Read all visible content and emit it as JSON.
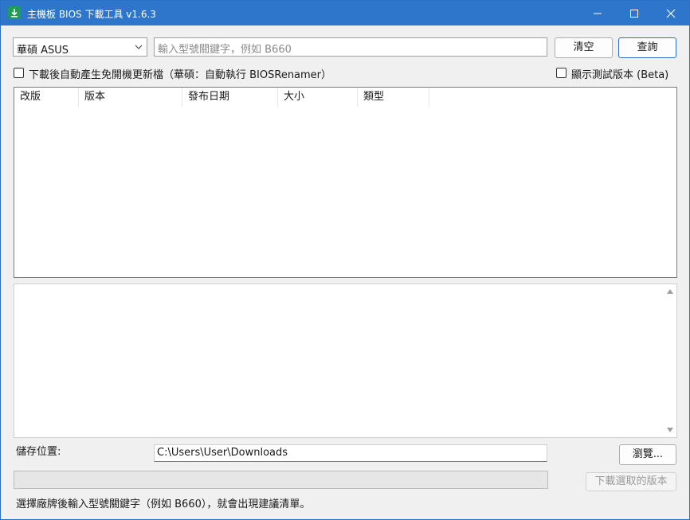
{
  "window": {
    "title": "主機板 BIOS 下載工具  v1.6.3",
    "icon": "download-arrow-icon"
  },
  "toolbar": {
    "brand_selected": "華碩 ASUS",
    "search_placeholder": "輸入型號關鍵字，例如 B660",
    "search_value": "",
    "clear_label": "清空",
    "query_label": "查詢"
  },
  "options": {
    "rename_label": "下載後自動產生免開機更新檔（華碩：自動執行 BIOSRenamer）",
    "rename_checked": false,
    "beta_label": "顯示測試版本 (Beta)",
    "beta_checked": false
  },
  "table": {
    "columns": [
      "改版",
      "版本",
      "發布日期",
      "大小",
      "類型"
    ],
    "rows": []
  },
  "log": {
    "text": ""
  },
  "save": {
    "label": "儲存位置:",
    "path": "C:\\Users\\User\\Downloads",
    "browse_label": "瀏覽..."
  },
  "progress": {
    "value": 0
  },
  "download": {
    "label": "下載選取的版本",
    "enabled": false
  },
  "status": {
    "text": "選擇廠牌後輸入型號關鍵字（例如 B660），就會出現建議清單。"
  },
  "colors": {
    "titlebar": "#2d76cc",
    "accent": "#2b6fc2",
    "window_bg": "#f0f0f0"
  }
}
